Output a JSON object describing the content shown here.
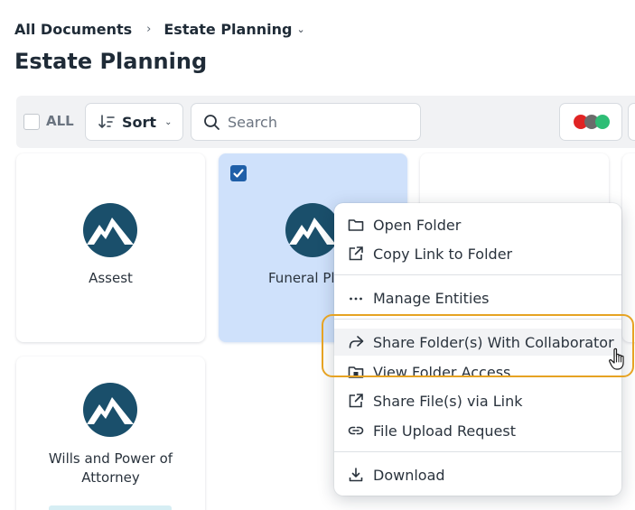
{
  "breadcrumb": {
    "root": "All Documents",
    "separator": "›",
    "current": "Estate Planning",
    "dropdown_icon": "chevron-down-icon"
  },
  "page_title": "Estate Planning",
  "toolbar": {
    "select_all_label": "ALL",
    "sort_label": "Sort",
    "search_placeholder": "Search",
    "color_filter_dots": [
      "#e02424",
      "#6b6b6b",
      "#2ebd75"
    ]
  },
  "folders": [
    {
      "name": "Assest",
      "selected": false
    },
    {
      "name": "Funeral Pl",
      "selected": true
    },
    {
      "name": "Wills and Power of",
      "name_line2": "Attorney",
      "selected": false
    }
  ],
  "context_menu": {
    "items": [
      {
        "label": "Open Folder",
        "icon": "folder-icon"
      },
      {
        "label": "Copy Link to Folder",
        "icon": "external-link-icon"
      },
      {
        "label": "Manage Entities",
        "icon": "ellipsis-icon"
      },
      {
        "label": "Share Folder(s) With Collaborator",
        "icon": "share-arrow-icon",
        "highlighted": true
      },
      {
        "label": "View Folder Access",
        "icon": "folder-lock-icon"
      },
      {
        "label": "Share File(s) via Link",
        "icon": "external-link-icon"
      },
      {
        "label": "File Upload Request",
        "icon": "link-icon"
      },
      {
        "label": "Download",
        "icon": "download-icon"
      }
    ]
  },
  "colors": {
    "accent": "#1f5fa8",
    "selected_card": "#cfe1fb",
    "highlight_ring": "#e6a323",
    "logo_circle": "#1a4f6b"
  }
}
